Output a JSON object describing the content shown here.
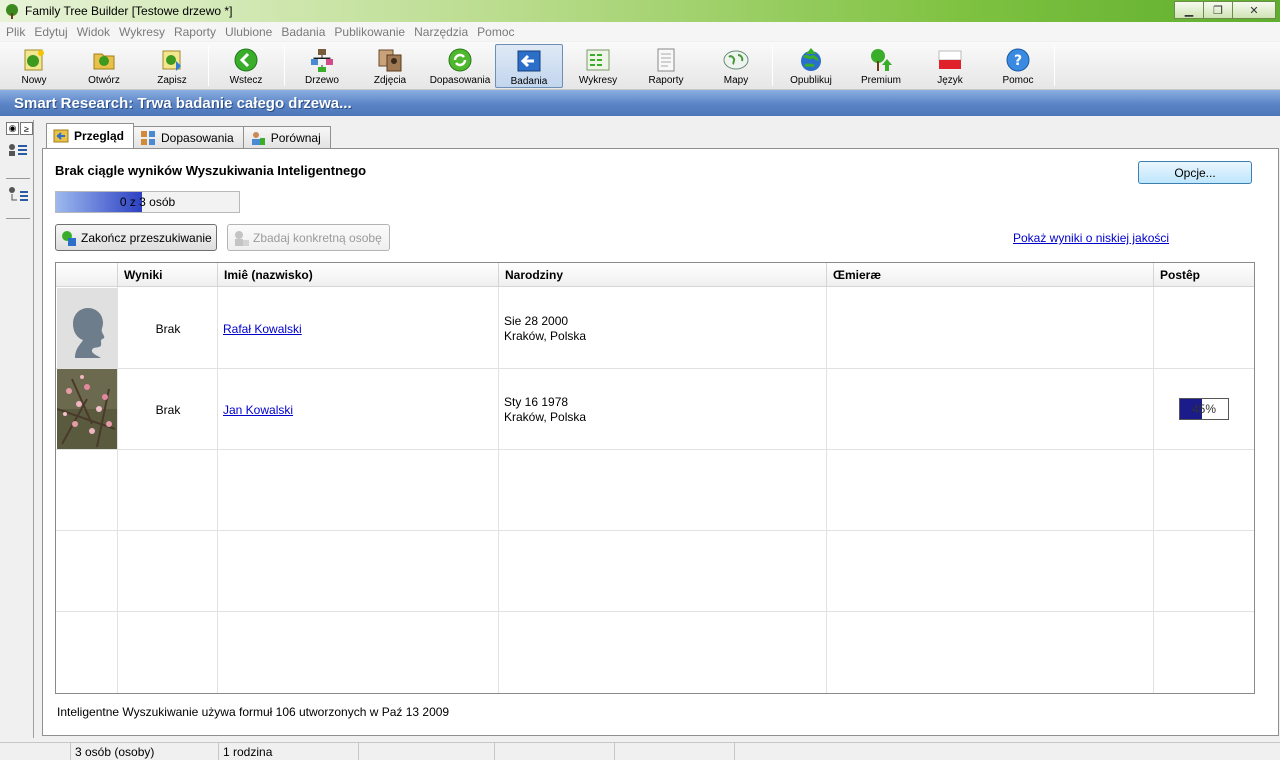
{
  "window": {
    "title": "Family Tree Builder [Testowe drzewo *]",
    "minimize": "▁",
    "restore": "❐",
    "close": "✕"
  },
  "menu": [
    "Plik",
    "Edytuj",
    "Widok",
    "Wykresy",
    "Raporty",
    "Ulubione",
    "Badania",
    "Publikowanie",
    "Narzędzia",
    "Pomoc"
  ],
  "toolbar": {
    "nowy": "Nowy",
    "otworz": "Otwórz",
    "zapisz": "Zapisz",
    "wstecz": "Wstecz",
    "drzewo": "Drzewo",
    "zdjecia": "Zdjęcia",
    "dopasowania": "Dopasowania",
    "badania": "Badania",
    "wykresy": "Wykresy",
    "raporty": "Raporty",
    "mapy": "Mapy",
    "opublikuj": "Opublikuj",
    "premium": "Premium",
    "jezyk": "Język",
    "pomoc": "Pomoc"
  },
  "banner": {
    "title": "Smart Research: Trwa badanie całego drzewa..."
  },
  "left_panel": {
    "toggle_a": "◉",
    "toggle_b": "≥"
  },
  "tabs": {
    "przeglad": "Przegląd",
    "dopasowania": "Dopasowania",
    "porownaj": "Porównaj"
  },
  "overview": {
    "heading": "Brak ciągle wyników Wyszukiwania Inteligentnego",
    "progress_text": "0 z 3 osób",
    "progress_fraction": 0.47,
    "stop_button": "Zakończ przeszukiwanie",
    "research_person_button": "Zbadaj konkretną osobę",
    "options_button": "Opcje...",
    "low_quality_link": "Pokaż wyniki o niskiej jakości",
    "footer": "Inteligentne Wyszukiwanie używa formuł 106 utworzonych w Paź 13 2009"
  },
  "grid": {
    "headers": {
      "wyniki": "Wyniki",
      "imie": "Imiê (nazwisko)",
      "narodziny": "Narodziny",
      "smierc": "Œmieræ",
      "postep": "Postêp"
    },
    "rows": [
      {
        "wyniki": "Brak",
        "name": "Rafał Kowalski",
        "birth_date": "Sie 28 2000",
        "birth_place": "Kraków, Polska",
        "photo": "silhouette"
      },
      {
        "wyniki": "Brak",
        "name": "Jan Kowalski",
        "birth_date": "Sty 16 1978",
        "birth_place": "Kraków, Polska",
        "photo": "blossom",
        "progress_text": "45%",
        "progress_value": 0.45
      }
    ]
  },
  "statusbar": {
    "persons": "3 osób (osoby)",
    "families": "1 rodzina"
  },
  "colors": {
    "banner": "#5a84c6",
    "link": "#0000cc",
    "progress": "#1b1b8a"
  }
}
